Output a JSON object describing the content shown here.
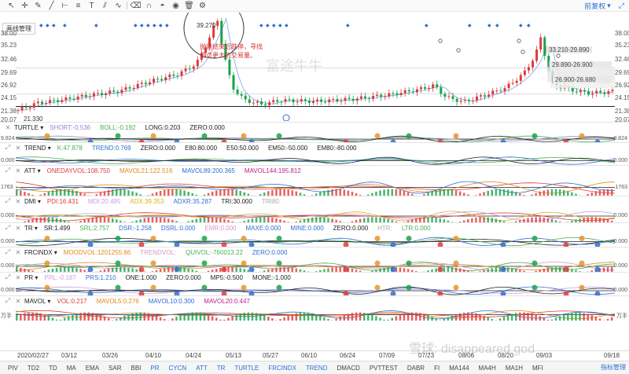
{
  "toolbar": {
    "icons": [
      "arrow-icon",
      "crosshair-icon",
      "pen-icon",
      "line-icon",
      "ruler-icon",
      "fib-icon",
      "text-icon",
      "channel-icon",
      "wave-icon",
      "eraser-icon",
      "magnet-icon",
      "lock-icon",
      "eye-icon",
      "trash-icon",
      "settings-icon"
    ],
    "adjust_label": "前复权",
    "tool_hint": "画线管理"
  },
  "main_chart": {
    "price_left": [
      "38.00",
      "35.23",
      "32.46",
      "29.69",
      "26.92",
      "24.15",
      "21.38",
      "20.07"
    ],
    "price_right": [
      "38.00",
      "35.23",
      "32.46",
      "29.69",
      "26.92",
      "24.15",
      "21.38",
      "20.07"
    ],
    "high_label": "39.270",
    "low_label": "21.330",
    "annotation_line1": "抛盘结束后跌停，寻找",
    "annotation_line2": "低点更大的交易量。",
    "range_tags": [
      "33.210-29.890",
      "29.890-26.900",
      "26.900-26.680"
    ],
    "watermark": "富途牛牛",
    "colors": {
      "up": "#e03a3a",
      "down": "#1aa34a",
      "ma": "#2f6fd0"
    }
  },
  "panels": [
    {
      "id": "turtle",
      "name": "TURTLE",
      "left_label": "9.824",
      "right_label": "9.824",
      "items": [
        {
          "label": "SHORT:-0.536",
          "color": "#9b7fd4"
        },
        {
          "label": "BOLL:-0.192",
          "color": "#4caf50"
        },
        {
          "label": "LONG:0.203",
          "color": "#222222"
        },
        {
          "label": "ZERO:0.000",
          "color": "#222222"
        }
      ]
    },
    {
      "id": "trend",
      "name": "TREND",
      "left_label": "0.000",
      "right_label": "0.000",
      "items": [
        {
          "label": "K:47.878",
          "color": "#4caf50"
        },
        {
          "label": "TREND:0.769",
          "color": "#2f6fd0"
        },
        {
          "label": "ZERO:0.000",
          "color": "#222222"
        },
        {
          "label": "E80:80.000",
          "color": "#222222"
        },
        {
          "label": "E50:50.000",
          "color": "#222222"
        },
        {
          "label": "EM50:-50.000",
          "color": "#222222"
        },
        {
          "label": "EM80:-80.000",
          "color": "#222222"
        }
      ]
    },
    {
      "id": "att",
      "name": "ATT",
      "left_label": "1763",
      "right_label": "1763",
      "items": [
        {
          "label": "ONEDAYVOL:108.750",
          "color": "#e03a3a"
        },
        {
          "label": "MAVOL21:122.516",
          "color": "#e08a1a"
        },
        {
          "label": "MAVOL89:200.365",
          "color": "#2f6fd0"
        },
        {
          "label": "MAVOL144:195.812",
          "color": "#c0208c"
        }
      ]
    },
    {
      "id": "dmi",
      "name": "DMI",
      "left_label": "0.000",
      "right_label": "0.000",
      "items": [
        {
          "label": "PDI:16.431",
          "color": "#e03a3a"
        },
        {
          "label": "MDI:20.495",
          "color": "#c9a0e0"
        },
        {
          "label": "ADX:39.353",
          "color": "#e0b01a"
        },
        {
          "label": "ADXR:35.287",
          "color": "#2f6fd0"
        },
        {
          "label": "TRI:30.000",
          "color": "#222222"
        },
        {
          "label": "TRI80:",
          "color": "#aaaaaa"
        }
      ]
    },
    {
      "id": "tr",
      "name": "TR",
      "left_label": "0.000",
      "right_label": "0.000",
      "items": [
        {
          "label": "SR:1.499",
          "color": "#222222"
        },
        {
          "label": "SRL:2.757",
          "color": "#4caf50"
        },
        {
          "label": "DSR:-1.258",
          "color": "#2f6fd0"
        },
        {
          "label": "DSRL:0.000",
          "color": "#2f6fd0"
        },
        {
          "label": "EMR:0.000",
          "color": "#d898c0"
        },
        {
          "label": "MAXE:0.000",
          "color": "#2f6fd0"
        },
        {
          "label": "MINE:0.000",
          "color": "#2f6fd0"
        },
        {
          "label": "ZERO:0.000",
          "color": "#222222"
        },
        {
          "label": "HTR:",
          "color": "#aaaaaa"
        },
        {
          "label": "LTR:0.000",
          "color": "#4caf50"
        }
      ]
    },
    {
      "id": "frcindx",
      "name": "FRCINDX",
      "left_label": "0.000",
      "right_label": "0.000",
      "items": [
        {
          "label": "MOODVOL:1201255.86",
          "color": "#e08a1a"
        },
        {
          "label": "TRENDVOL:",
          "color": "#d898c0"
        },
        {
          "label": "QUIVOL:-760013.22",
          "color": "#4caf50"
        },
        {
          "label": "ZERO:0.000",
          "color": "#2f6fd0"
        }
      ]
    },
    {
      "id": "pr",
      "name": "PR",
      "left_label": "0.000",
      "right_label": "0.000",
      "items": [
        {
          "label": "PRL:-0.187",
          "color": "#c9a0e0"
        },
        {
          "label": "PRS:1.210",
          "color": "#2f6fd0"
        },
        {
          "label": "ONE:1.000",
          "color": "#222222"
        },
        {
          "label": "ZERO:0.000",
          "color": "#222222"
        },
        {
          "label": "MP5:-0.500",
          "color": "#222222"
        },
        {
          "label": "MONE:-1.000",
          "color": "#222222"
        }
      ]
    },
    {
      "id": "mavol",
      "name": "MAVOL",
      "left_label": "万手",
      "right_label": "万手",
      "items": [
        {
          "label": "VOL:0.217",
          "color": "#e03a3a"
        },
        {
          "label": "MAVOL5:0.276",
          "color": "#e08a1a"
        },
        {
          "label": "MAVOL10:0.300",
          "color": "#2f6fd0"
        },
        {
          "label": "MAVOL20:0.447",
          "color": "#c0208c"
        }
      ]
    }
  ],
  "dates": [
    "2020/02/27",
    "03/12",
    "03/26",
    "04/10",
    "04/24",
    "05/13",
    "05/27",
    "06/10",
    "06/24",
    "07/09",
    "07/23",
    "08/06",
    "08/20",
    "09/03",
    "09/18"
  ],
  "indicator_tabs": [
    "PIV",
    "TD2",
    "TD",
    "MA",
    "EMA",
    "SAR",
    "BBI",
    "PR",
    "CYCN",
    "ATT",
    "TR",
    "TURTLE",
    "FRCINDX",
    "TREND",
    "DMACD",
    "PVTTEST",
    "DABR",
    "FI",
    "MA144",
    "MA4H",
    "MA1H",
    "MFI"
  ],
  "active_tabs": [
    "PR",
    "CYCN",
    "ATT",
    "TR",
    "TURTLE",
    "FRCINDX",
    "TREND"
  ],
  "manage_label": "指标管理",
  "footer_watermark": "雪球: disappeared god"
}
